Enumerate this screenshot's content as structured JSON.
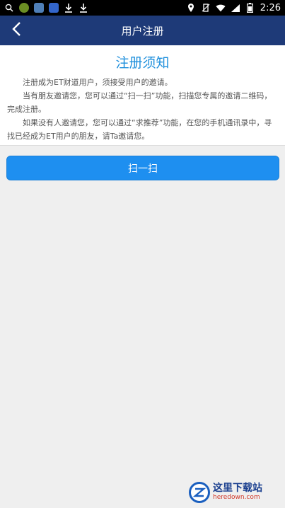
{
  "status_bar": {
    "time": "2:26"
  },
  "nav": {
    "title": "用户注册"
  },
  "notice": {
    "title": "注册须知",
    "paragraphs": [
      "注册成为ET财道用户，须接受用户的邀请。",
      "当有朋友邀请您，您可以通过“扫一扫”功能，扫描您专属的邀请二维码，完成注册。",
      "如果没有人邀请您，您可以通过“求推荐”功能，在您的手机通讯录中，寻找已经成为ET用户的朋友，请Ta邀请您。"
    ]
  },
  "actions": {
    "scan_label": "扫一扫"
  },
  "watermark": {
    "cn": "这里下载站",
    "en": "heredown.com"
  },
  "colors": {
    "nav_bg": "#1e3a78",
    "accent": "#1e8ff0",
    "title_blue": "#1e8fdc"
  }
}
